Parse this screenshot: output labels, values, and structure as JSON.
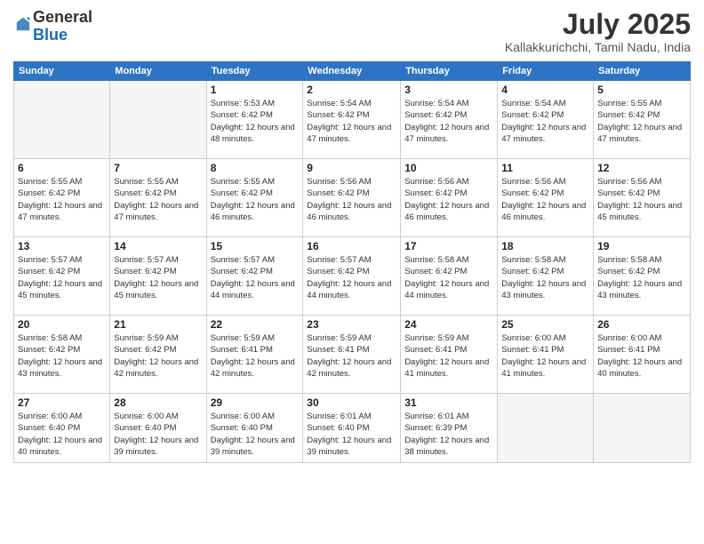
{
  "logo": {
    "general": "General",
    "blue": "Blue"
  },
  "title": "July 2025",
  "subtitle": "Kallakkurichchi, Tamil Nadu, India",
  "days_of_week": [
    "Sunday",
    "Monday",
    "Tuesday",
    "Wednesday",
    "Thursday",
    "Friday",
    "Saturday"
  ],
  "weeks": [
    [
      {
        "day": "",
        "info": ""
      },
      {
        "day": "",
        "info": ""
      },
      {
        "day": "1",
        "info": "Sunrise: 5:53 AM\nSunset: 6:42 PM\nDaylight: 12 hours and 48 minutes."
      },
      {
        "day": "2",
        "info": "Sunrise: 5:54 AM\nSunset: 6:42 PM\nDaylight: 12 hours and 47 minutes."
      },
      {
        "day": "3",
        "info": "Sunrise: 5:54 AM\nSunset: 6:42 PM\nDaylight: 12 hours and 47 minutes."
      },
      {
        "day": "4",
        "info": "Sunrise: 5:54 AM\nSunset: 6:42 PM\nDaylight: 12 hours and 47 minutes."
      },
      {
        "day": "5",
        "info": "Sunrise: 5:55 AM\nSunset: 6:42 PM\nDaylight: 12 hours and 47 minutes."
      }
    ],
    [
      {
        "day": "6",
        "info": "Sunrise: 5:55 AM\nSunset: 6:42 PM\nDaylight: 12 hours and 47 minutes."
      },
      {
        "day": "7",
        "info": "Sunrise: 5:55 AM\nSunset: 6:42 PM\nDaylight: 12 hours and 47 minutes."
      },
      {
        "day": "8",
        "info": "Sunrise: 5:55 AM\nSunset: 6:42 PM\nDaylight: 12 hours and 46 minutes."
      },
      {
        "day": "9",
        "info": "Sunrise: 5:56 AM\nSunset: 6:42 PM\nDaylight: 12 hours and 46 minutes."
      },
      {
        "day": "10",
        "info": "Sunrise: 5:56 AM\nSunset: 6:42 PM\nDaylight: 12 hours and 46 minutes."
      },
      {
        "day": "11",
        "info": "Sunrise: 5:56 AM\nSunset: 6:42 PM\nDaylight: 12 hours and 46 minutes."
      },
      {
        "day": "12",
        "info": "Sunrise: 5:56 AM\nSunset: 6:42 PM\nDaylight: 12 hours and 45 minutes."
      }
    ],
    [
      {
        "day": "13",
        "info": "Sunrise: 5:57 AM\nSunset: 6:42 PM\nDaylight: 12 hours and 45 minutes."
      },
      {
        "day": "14",
        "info": "Sunrise: 5:57 AM\nSunset: 6:42 PM\nDaylight: 12 hours and 45 minutes."
      },
      {
        "day": "15",
        "info": "Sunrise: 5:57 AM\nSunset: 6:42 PM\nDaylight: 12 hours and 44 minutes."
      },
      {
        "day": "16",
        "info": "Sunrise: 5:57 AM\nSunset: 6:42 PM\nDaylight: 12 hours and 44 minutes."
      },
      {
        "day": "17",
        "info": "Sunrise: 5:58 AM\nSunset: 6:42 PM\nDaylight: 12 hours and 44 minutes."
      },
      {
        "day": "18",
        "info": "Sunrise: 5:58 AM\nSunset: 6:42 PM\nDaylight: 12 hours and 43 minutes."
      },
      {
        "day": "19",
        "info": "Sunrise: 5:58 AM\nSunset: 6:42 PM\nDaylight: 12 hours and 43 minutes."
      }
    ],
    [
      {
        "day": "20",
        "info": "Sunrise: 5:58 AM\nSunset: 6:42 PM\nDaylight: 12 hours and 43 minutes."
      },
      {
        "day": "21",
        "info": "Sunrise: 5:59 AM\nSunset: 6:42 PM\nDaylight: 12 hours and 42 minutes."
      },
      {
        "day": "22",
        "info": "Sunrise: 5:59 AM\nSunset: 6:41 PM\nDaylight: 12 hours and 42 minutes."
      },
      {
        "day": "23",
        "info": "Sunrise: 5:59 AM\nSunset: 6:41 PM\nDaylight: 12 hours and 42 minutes."
      },
      {
        "day": "24",
        "info": "Sunrise: 5:59 AM\nSunset: 6:41 PM\nDaylight: 12 hours and 41 minutes."
      },
      {
        "day": "25",
        "info": "Sunrise: 6:00 AM\nSunset: 6:41 PM\nDaylight: 12 hours and 41 minutes."
      },
      {
        "day": "26",
        "info": "Sunrise: 6:00 AM\nSunset: 6:41 PM\nDaylight: 12 hours and 40 minutes."
      }
    ],
    [
      {
        "day": "27",
        "info": "Sunrise: 6:00 AM\nSunset: 6:40 PM\nDaylight: 12 hours and 40 minutes."
      },
      {
        "day": "28",
        "info": "Sunrise: 6:00 AM\nSunset: 6:40 PM\nDaylight: 12 hours and 39 minutes."
      },
      {
        "day": "29",
        "info": "Sunrise: 6:00 AM\nSunset: 6:40 PM\nDaylight: 12 hours and 39 minutes."
      },
      {
        "day": "30",
        "info": "Sunrise: 6:01 AM\nSunset: 6:40 PM\nDaylight: 12 hours and 39 minutes."
      },
      {
        "day": "31",
        "info": "Sunrise: 6:01 AM\nSunset: 6:39 PM\nDaylight: 12 hours and 38 minutes."
      },
      {
        "day": "",
        "info": ""
      },
      {
        "day": "",
        "info": ""
      }
    ]
  ]
}
